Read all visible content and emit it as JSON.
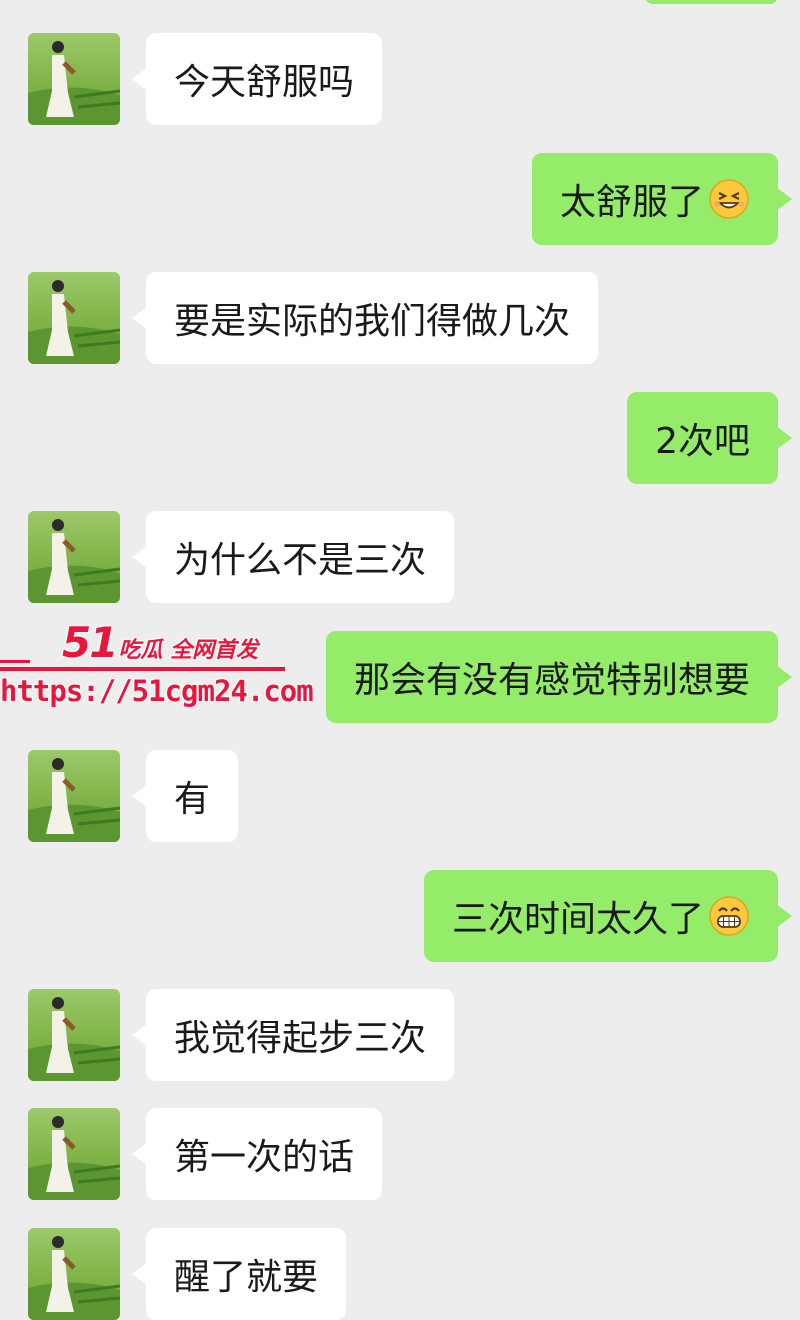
{
  "messages": [
    {
      "side": "in",
      "text": "今天舒服吗",
      "emoji": ""
    },
    {
      "side": "out",
      "text": "太舒服了",
      "emoji": "grin-squint-emoji-icon"
    },
    {
      "side": "in",
      "text": "要是实际的我们得做几次",
      "emoji": ""
    },
    {
      "side": "out",
      "text": "2次吧",
      "emoji": ""
    },
    {
      "side": "in",
      "text": "为什么不是三次",
      "emoji": ""
    },
    {
      "side": "out",
      "text": "那会有没有感觉特别想要",
      "emoji": ""
    },
    {
      "side": "in",
      "text": "有",
      "emoji": ""
    },
    {
      "side": "out",
      "text": "三次时间太久了",
      "emoji": "grin-emoji-icon"
    },
    {
      "side": "in",
      "text": "我觉得起步三次",
      "emoji": ""
    },
    {
      "side": "in",
      "text": "第一次的话",
      "emoji": ""
    },
    {
      "side": "in",
      "text": "醒了就要",
      "emoji": ""
    }
  ],
  "watermark": {
    "number": "51",
    "tagline": "吃瓜 全网首发",
    "url": "https://51cgm24.com"
  },
  "colors": {
    "background": "#ededed",
    "incoming_bubble": "#ffffff",
    "outgoing_bubble": "#95ec69",
    "watermark": "#e8163d"
  }
}
